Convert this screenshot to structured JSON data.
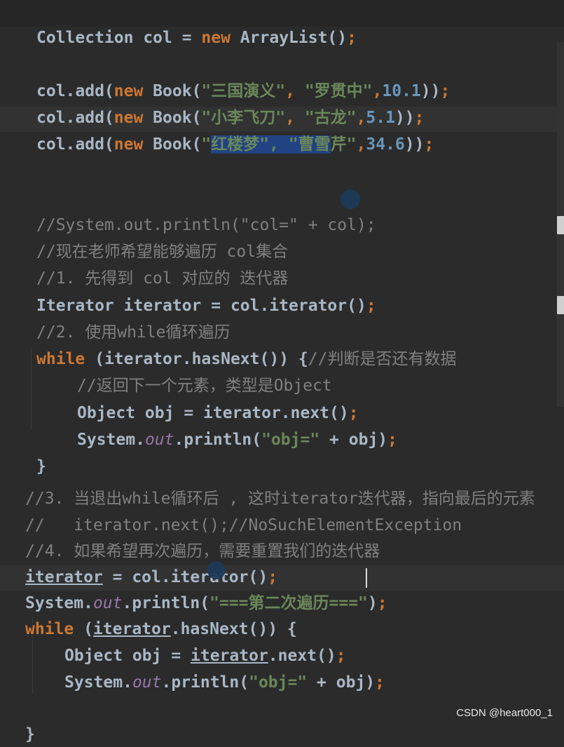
{
  "code": {
    "l1": [
      "Collection col = ",
      "new",
      " ArrayList()",
      ";"
    ],
    "l2": [
      "col.add(",
      "new",
      " Book(",
      "\"三国演义\"",
      ", ",
      "\"罗贯中\"",
      ",",
      "10.1",
      "))",
      ";"
    ],
    "l3": [
      "col.add(",
      "new",
      " Book(",
      "\"小李飞刀\"",
      ", ",
      "\"古龙\"",
      ",",
      "5.1",
      "))",
      ";"
    ],
    "l4": [
      "col.add(",
      "new",
      " Book(",
      "\"",
      "红楼梦\", \"曹雪",
      "芹\"",
      ",",
      "34.6",
      "))",
      ";"
    ],
    "l5": [
      "//System.out.println(\"col=\" + col);"
    ],
    "l6": [
      "//现在老师希望能够遍历 col集合"
    ],
    "l7": [
      "//1. 先得到 col 对应的 迭代器"
    ],
    "l8": [
      "Iterator iterator = col.iterator()",
      ";"
    ],
    "l9": [
      "//2. 使用while循环遍历"
    ],
    "l10": [
      "while",
      " (iterator.hasNext()) {",
      "//判断是否还有数据"
    ],
    "l11": [
      "//返回下一个元素，类型是Object"
    ],
    "l12": [
      "Object obj = iterator.next()",
      ";"
    ],
    "l13": [
      "System.",
      "out",
      ".println(",
      "\"obj=\"",
      " + obj)",
      ";"
    ],
    "l14": [
      "}"
    ],
    "l15": [
      "//3. 当退出while循环后 , 这时iterator迭代器，指向最后的元素"
    ],
    "l16": [
      "//   iterator.next();//NoSuchElementException"
    ],
    "l17": [
      "//4. 如果希望再次遍历，需要重置我们的迭代器"
    ],
    "l18": [
      "iterator",
      " = col.iterator()",
      ";"
    ],
    "l19": [
      "System.",
      "out",
      ".println(",
      "\"===第二次遍历===",
      "\"",
      ")",
      ";"
    ],
    "l20": [
      "while",
      " (",
      "iterator",
      ".hasNext()) {"
    ],
    "l21": [
      "Object obj = ",
      "iterator",
      ".next()",
      ";"
    ],
    "l22": [
      "System.",
      "out",
      ".println(",
      "\"obj=\"",
      " + obj)",
      ";"
    ],
    "l23": [
      "}"
    ]
  },
  "watermark": "CSDN @heart000_1",
  "colors": {
    "background": "#2b2b2b",
    "keyword": "#cc7832",
    "string": "#6a8759",
    "number": "#6897bb",
    "comment": "#808080",
    "static_field": "#9876aa",
    "selection": "#214283"
  }
}
